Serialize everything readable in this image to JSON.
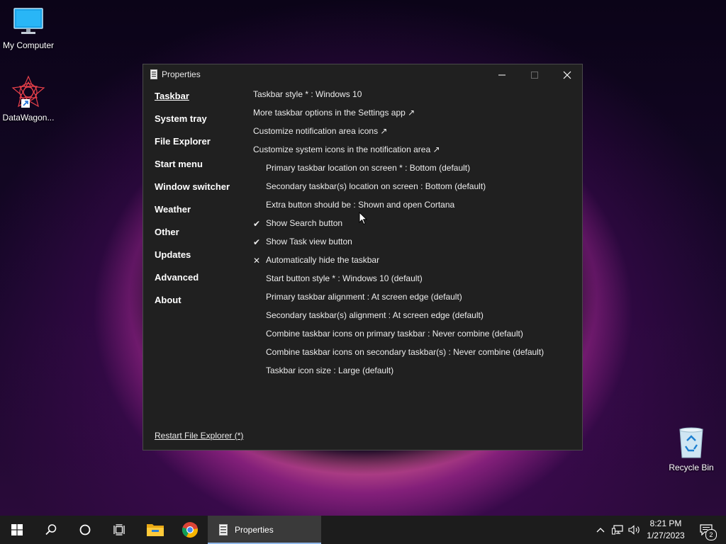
{
  "desktop": {
    "icons": [
      {
        "label": "My Computer"
      },
      {
        "label": "DataWagon..."
      },
      {
        "label": "Recycle Bin"
      }
    ]
  },
  "window": {
    "title": "Properties",
    "sidebar": {
      "items": [
        {
          "label": "Taskbar",
          "active": true
        },
        {
          "label": "System tray"
        },
        {
          "label": "File Explorer"
        },
        {
          "label": "Start menu"
        },
        {
          "label": "Window switcher"
        },
        {
          "label": "Weather"
        },
        {
          "label": "Other"
        },
        {
          "label": "Updates"
        },
        {
          "label": "Advanced"
        },
        {
          "label": "About"
        }
      ],
      "restart_link": "Restart File Explorer (*)"
    },
    "settings": [
      {
        "label": "Taskbar style * : Windows 10"
      },
      {
        "label": "More taskbar options in the Settings app ↗"
      },
      {
        "label": "Customize notification area icons ↗"
      },
      {
        "label": "Customize system icons in the notification area ↗"
      },
      {
        "label": "Primary taskbar location on screen * : Bottom (default)"
      },
      {
        "label": "Secondary taskbar(s) location on screen : Bottom (default)"
      },
      {
        "label": "Extra button should be : Shown and open Cortana"
      },
      {
        "label": "Show Search button",
        "mark": "✔"
      },
      {
        "label": "Show Task view button",
        "mark": "✔"
      },
      {
        "label": "Automatically hide the taskbar",
        "mark": "✕"
      },
      {
        "label": "Start button style * : Windows 10 (default)"
      },
      {
        "label": "Primary taskbar alignment : At screen edge (default)"
      },
      {
        "label": "Secondary taskbar(s) alignment : At screen edge (default)"
      },
      {
        "label": "Combine taskbar icons on primary taskbar : Never combine (default)"
      },
      {
        "label": "Combine taskbar icons on secondary taskbar(s) : Never combine (default)"
      },
      {
        "label": "Taskbar icon size : Large (default)"
      }
    ]
  },
  "taskbar": {
    "active_app_label": "Properties",
    "clock": {
      "time": "8:21 PM",
      "date": "1/27/2023"
    },
    "notification_count": "2"
  }
}
